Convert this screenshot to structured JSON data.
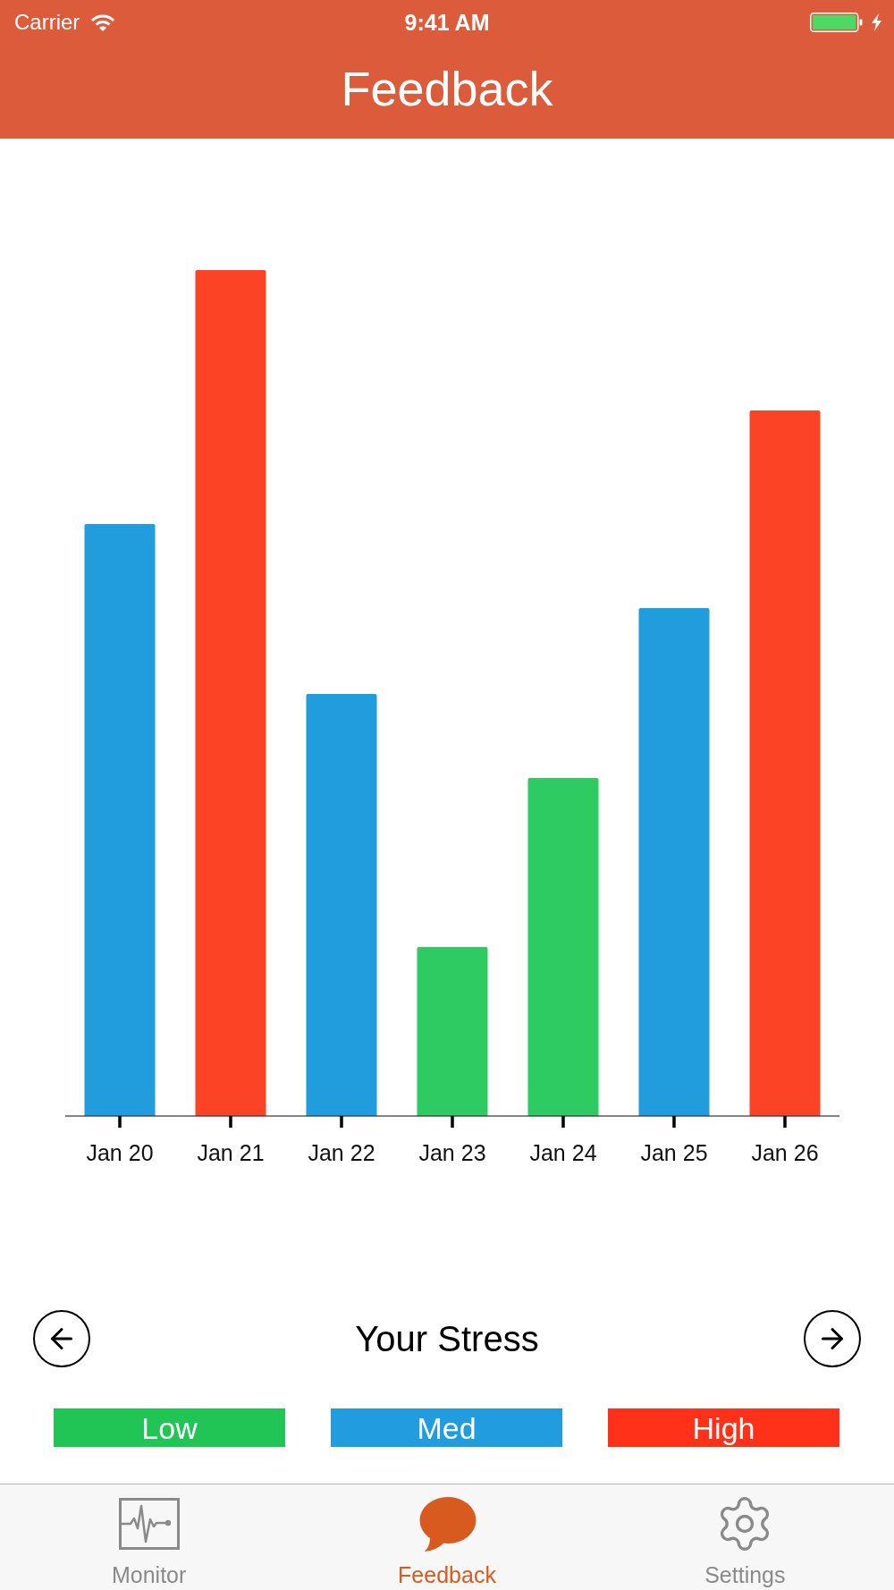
{
  "status_bar": {
    "carrier": "Carrier",
    "time": "9:41 AM"
  },
  "nav_bar": {
    "title": "Feedback"
  },
  "stress_chart": {
    "bars": [
      {
        "label": "Jan 20",
        "color": "#219cdd"
      },
      {
        "label": "Jan 21",
        "color": "#fd4326"
      },
      {
        "label": "Jan 22",
        "color": "#219cdd"
      },
      {
        "label": "Jan 23",
        "color": "#2dcb62"
      },
      {
        "label": "Jan 24",
        "color": "#2dcb62"
      },
      {
        "label": "Jan 25",
        "color": "#219cdd"
      },
      {
        "label": "Jan 26",
        "color": "#fd4326"
      }
    ]
  },
  "stress_panel": {
    "title": "Your Stress"
  },
  "legend": [
    {
      "label": "Low",
      "color": "#20c556"
    },
    {
      "label": "Med",
      "color": "#209cdf"
    },
    {
      "label": "High",
      "color": "#ff3219"
    }
  ],
  "tabs": [
    {
      "label": "Monitor",
      "selected": false
    },
    {
      "label": "Feedback",
      "selected": true
    },
    {
      "label": "Settings",
      "selected": false
    }
  ]
}
